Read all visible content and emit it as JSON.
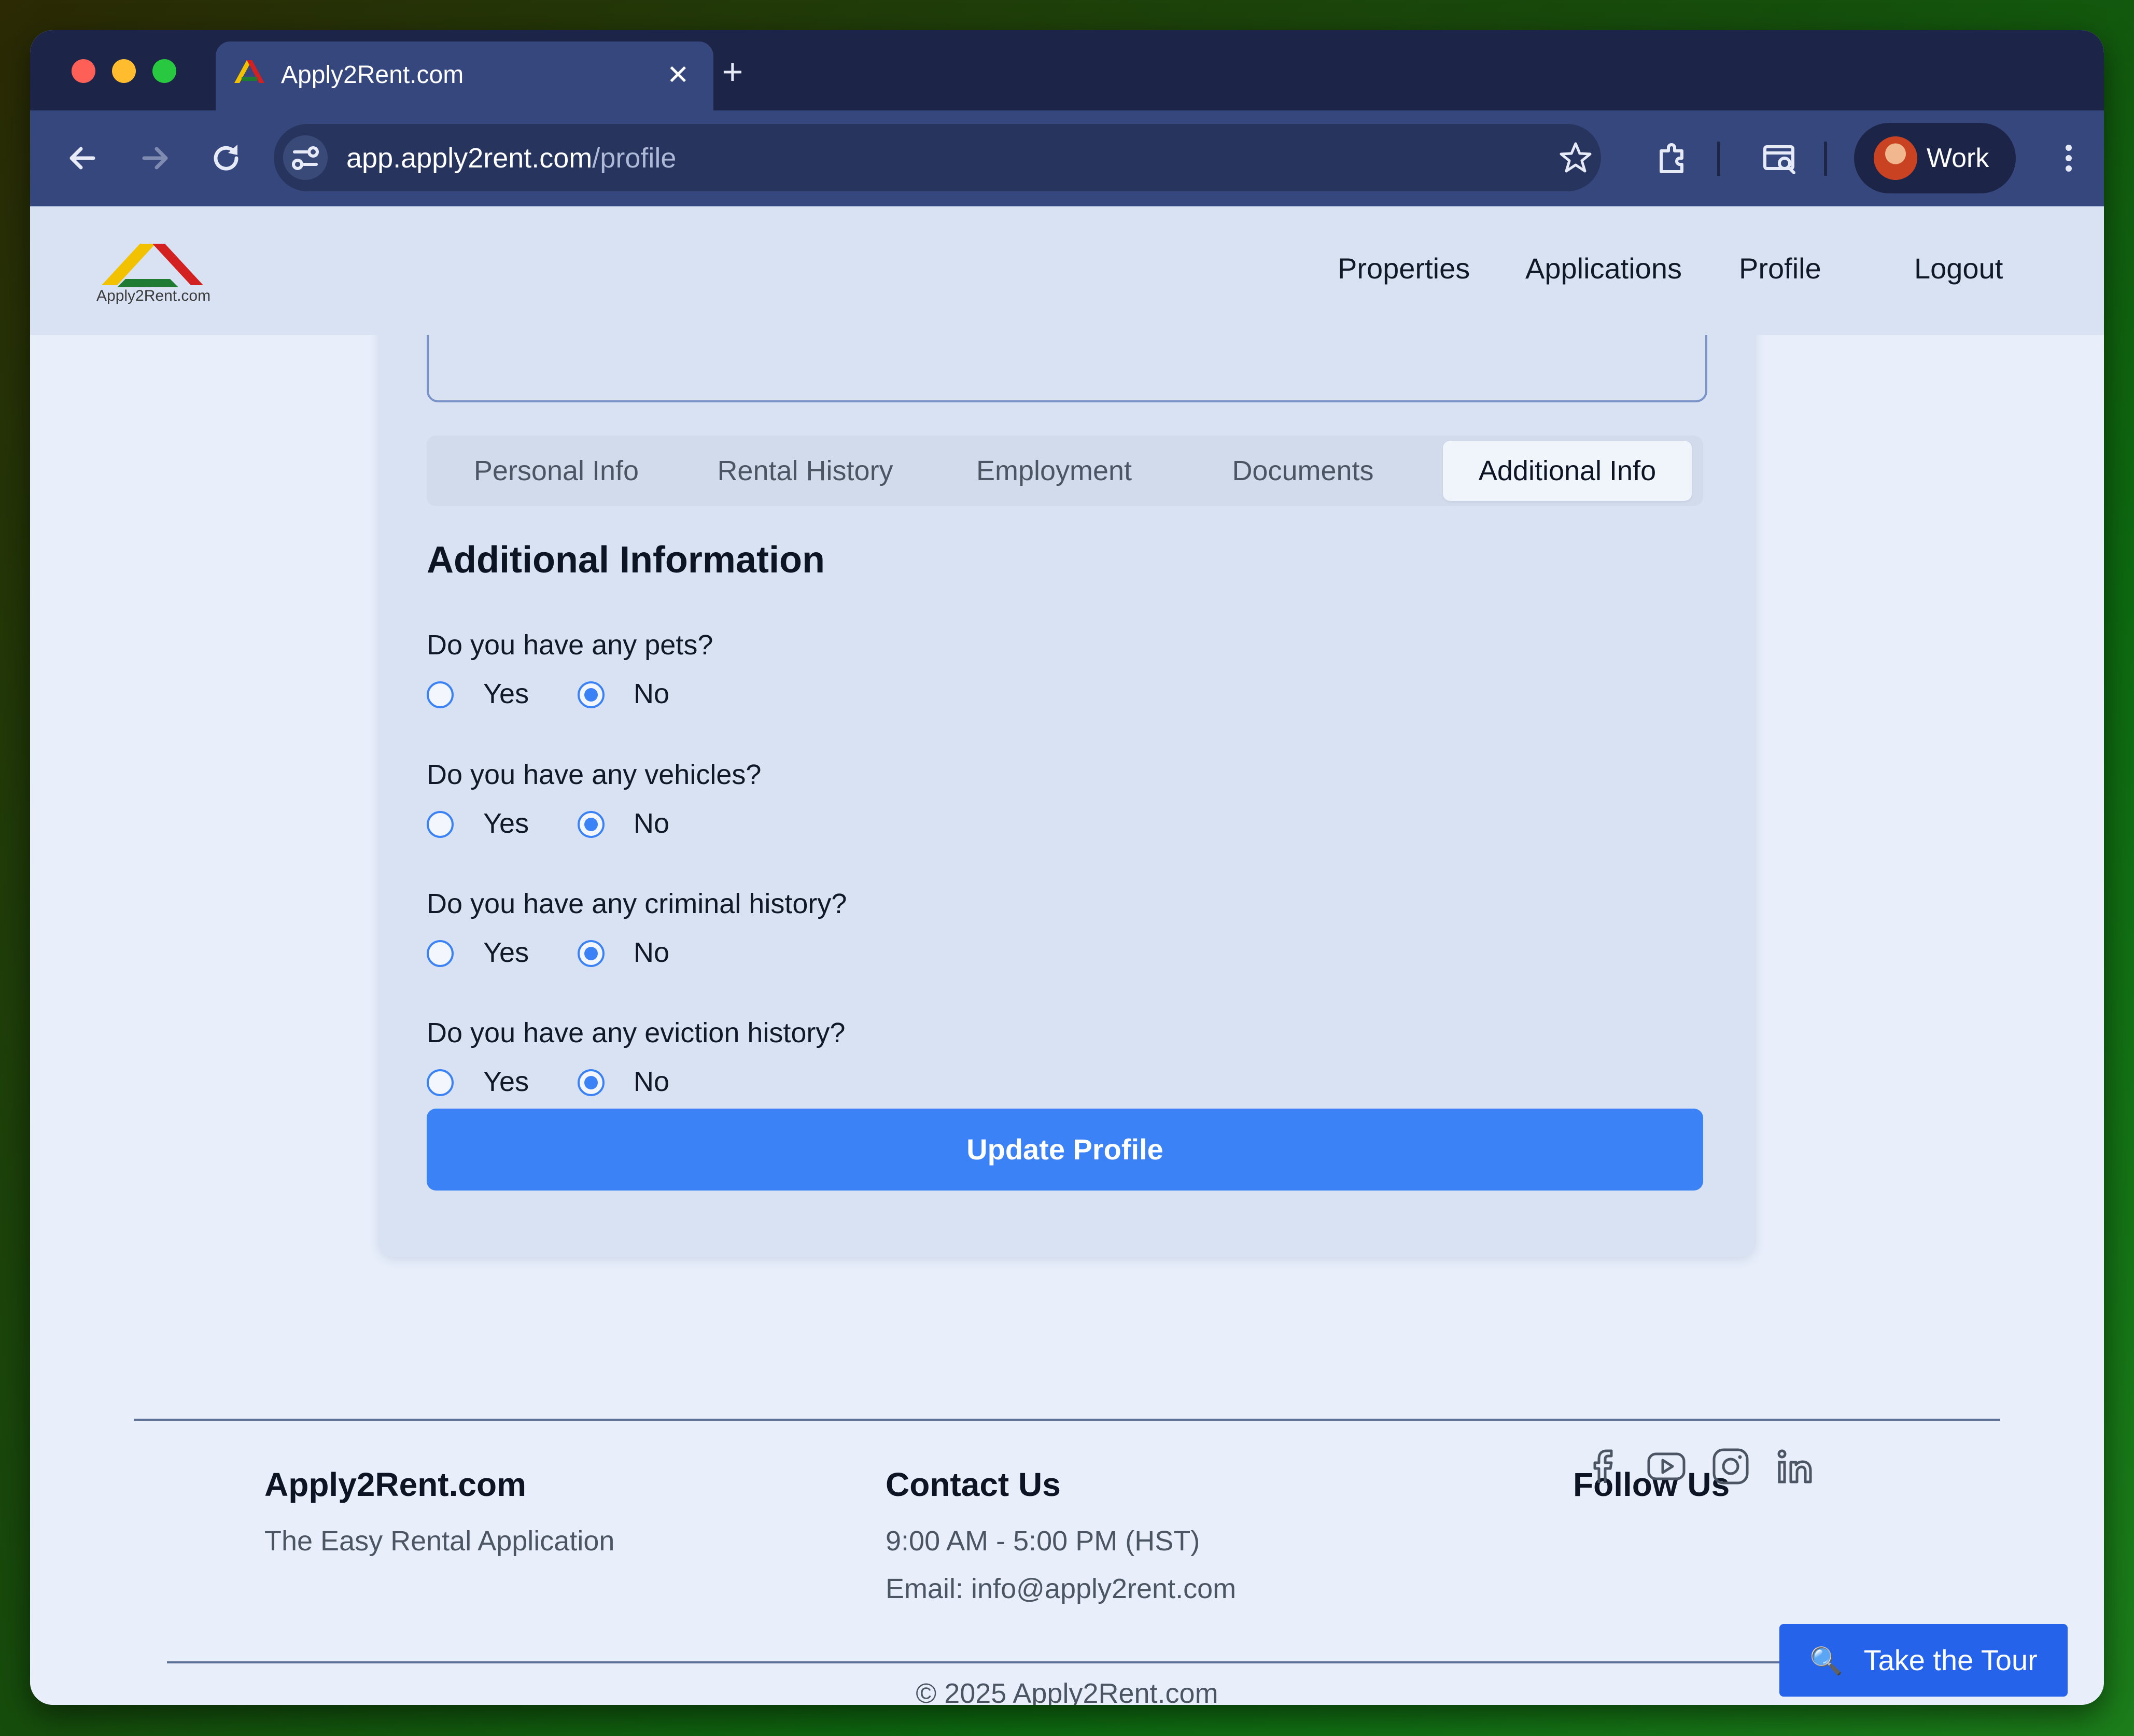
{
  "browser": {
    "tab_title": "Apply2Rent.com",
    "new_tab_symbol": "+",
    "close_symbol": "✕",
    "url_host": "app.apply2rent.com",
    "url_path": "/profile",
    "profile_name": "Work"
  },
  "site": {
    "logo_text": "Apply2Rent.com",
    "nav": [
      "Properties",
      "Applications",
      "Profile",
      "Logout"
    ]
  },
  "form": {
    "tabs": [
      "Personal Info",
      "Rental History",
      "Employment",
      "Documents",
      "Additional Info"
    ],
    "active_tab": "Additional Info",
    "section_title": "Additional Information",
    "questions": [
      {
        "label": "Do you have any pets?",
        "yes": "Yes",
        "no": "No",
        "selected": "No"
      },
      {
        "label": "Do you have any vehicles?",
        "yes": "Yes",
        "no": "No",
        "selected": "No"
      },
      {
        "label": "Do you have any criminal history?",
        "yes": "Yes",
        "no": "No",
        "selected": "No"
      },
      {
        "label": "Do you have any eviction history?",
        "yes": "Yes",
        "no": "No",
        "selected": "No"
      }
    ],
    "submit_label": "Update Profile"
  },
  "footer": {
    "brand_title": "Apply2Rent.com",
    "brand_tagline": "The Easy Rental Application",
    "contact_title": "Contact Us",
    "contact_hours": "9:00 AM - 5:00 PM (HST)",
    "contact_email": "Email: info@apply2rent.com",
    "follow_title": "Follow Us",
    "social_icons": [
      "facebook-icon",
      "youtube-icon",
      "instagram-icon",
      "linkedin-icon"
    ],
    "copyright": "© 2025 Apply2Rent.com",
    "tour_label": "Take the Tour"
  },
  "colors": {
    "accent": "#3b82f6",
    "tour_button": "#2563eb",
    "browser_chrome": "#36477d",
    "tab_strip": "#1c2547"
  }
}
